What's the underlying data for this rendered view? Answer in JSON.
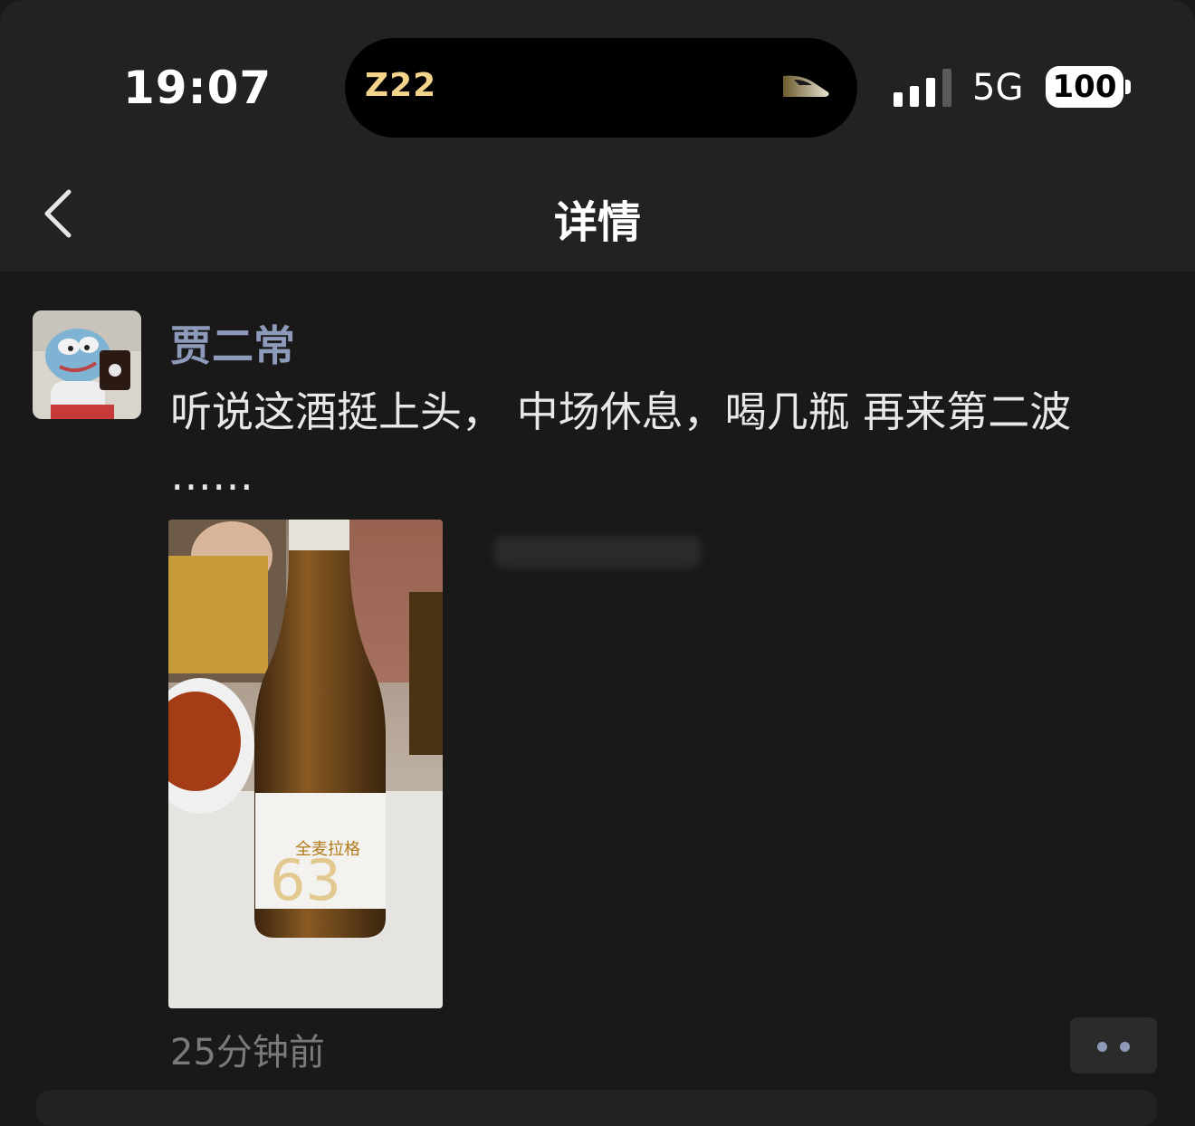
{
  "status_bar": {
    "time": "19:07",
    "island_text": "Z22",
    "network": "5G",
    "battery": "100",
    "signal_bars": 3,
    "signal_bars_total": 4
  },
  "nav": {
    "title": "详情",
    "back_icon": "chevron-left-icon"
  },
  "post": {
    "author": "贾二常",
    "text": "听说这酒挺上头， 中场休息，喝几瓶 再来第二波\n……",
    "timestamp": "25分钟前",
    "more_icon": "more-dots-icon"
  },
  "colors": {
    "background": "#191919",
    "header_background": "#222222",
    "author_name": "#8d9ab9",
    "island_text": "#f3d48a"
  }
}
